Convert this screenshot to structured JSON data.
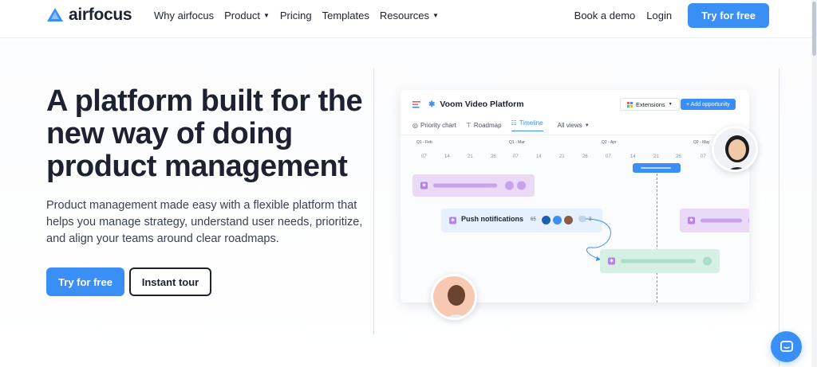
{
  "brand": {
    "name": "airfocus",
    "color": "#3a8ff6"
  },
  "nav": {
    "items": [
      {
        "label": "Why airfocus",
        "dropdown": false
      },
      {
        "label": "Product",
        "dropdown": true
      },
      {
        "label": "Pricing",
        "dropdown": false
      },
      {
        "label": "Templates",
        "dropdown": false
      },
      {
        "label": "Resources",
        "dropdown": true
      }
    ],
    "book_demo": "Book a demo",
    "login": "Login",
    "try_free": "Try for free"
  },
  "hero": {
    "headline": "A platform built for the new way of doing product management",
    "subheadline": "Product management made easy with a flexible platform that helps you manage strategy, understand user needs, prioritize, and align your teams around clear roadmaps.",
    "cta_primary": "Try for free",
    "cta_secondary": "Instant tour"
  },
  "mockup": {
    "title": "Voom Video Platform",
    "extensions": "Extensions",
    "add_opportunity": "+ Add opportunity",
    "views": [
      "Priority chart",
      "Roadmap",
      "Timeline"
    ],
    "active_view": "Timeline",
    "all_views": "All views",
    "quarters": [
      "Q1 - Feb",
      "Q1 - Mar",
      "Q2 - Apr",
      "Q2 - May"
    ],
    "days": [
      "07",
      "14",
      "21",
      "26",
      "07",
      "14",
      "21",
      "26",
      "07",
      "14",
      "21",
      "26",
      "07",
      "14",
      "21",
      "26",
      "07"
    ],
    "item": {
      "label": "Push notifications",
      "score": "65",
      "comments": "3"
    },
    "colors": {
      "purple": "#ead9f7",
      "blue": "#e6f1fd",
      "green": "#d6f1e4"
    }
  },
  "icons": [
    "airfocus-logo-icon",
    "chevron-down-icon",
    "list-icon",
    "star-icon",
    "extensions-icon",
    "priority-chart-icon",
    "roadmap-icon",
    "timeline-icon",
    "chat-icon"
  ]
}
